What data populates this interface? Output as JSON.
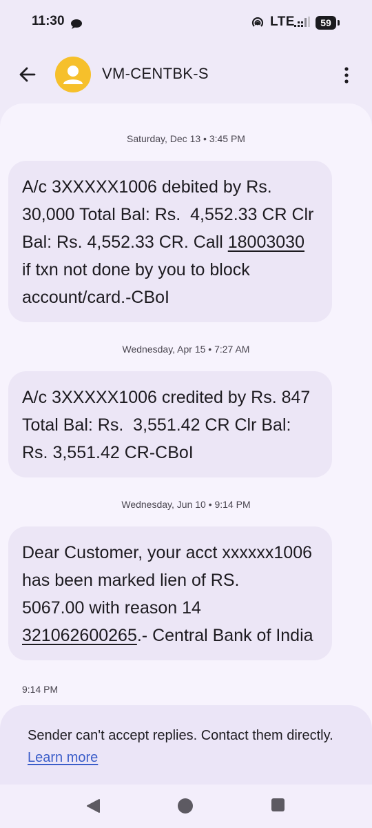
{
  "status_bar": {
    "time": "11:30",
    "network": "LTE",
    "battery": "59"
  },
  "app_bar": {
    "contact_name": "VM-CENTBK-S",
    "back_icon": "arrow-back-icon",
    "menu_icon": "more-vert-icon",
    "avatar_color": "#f6c02b"
  },
  "conversation": {
    "messages": [
      {
        "date": "Saturday, Dec 13 • 3:45 PM",
        "text_before_link": "A/c 3XXXXX1006 debited by Rs. 30,000 Total Bal: Rs.  4,552.33 CR Clr Bal: Rs. 4,552.33 CR. Call ",
        "link": "18003030",
        "text_after_link": " if txn not done by you to block account/card.-CBoI"
      },
      {
        "date": "Wednesday, Apr 15 • 7:27 AM",
        "text": "A/c 3XXXXX1006 credited by Rs. 847 Total Bal: Rs.  3,551.42 CR Clr Bal: Rs. 3,551.42 CR-CBoI"
      },
      {
        "date": "Wednesday, Jun 10 • 9:14 PM",
        "text_before_link": "Dear Customer, your acct xxxxxx1006 has been marked lien of RS.           5067.00 with reason 14 ",
        "link": "321062600265",
        "text_after_link": ".- Central Bank of India",
        "time": "9:14 PM"
      }
    ]
  },
  "footer": {
    "notice": "Sender can't accept replies. Contact them directly. ",
    "learn_more": "Learn more"
  },
  "colors": {
    "background": "#efeaf8",
    "panel": "#f7f3fd",
    "bubble": "#ece6f6",
    "link": "#3b5dc9"
  }
}
